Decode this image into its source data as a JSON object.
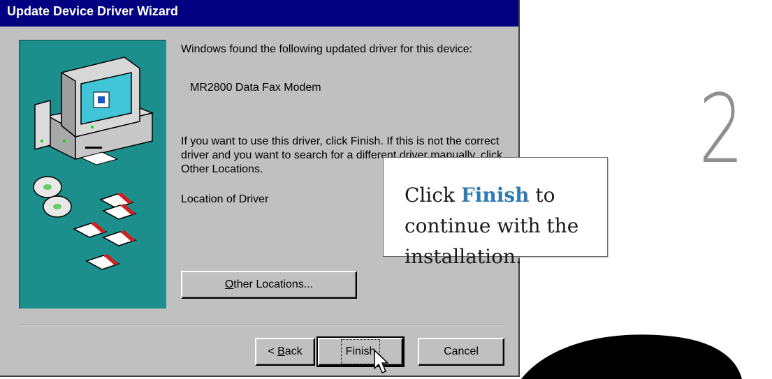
{
  "window": {
    "title": "Update Device Driver Wizard"
  },
  "content": {
    "found_text": "Windows found the following updated driver for this device:",
    "device_name": "MR2800 Data Fax Modem",
    "instruction_text": "If you want to use this driver, click Finish. If this is not the correct driver and you want to search for a different driver manually, click Other Locations.",
    "location_label": "Location of Driver"
  },
  "buttons": {
    "other_locations": {
      "mnemonic": "O",
      "rest": "ther Locations..."
    },
    "back": {
      "prefix": "< ",
      "mnemonic": "B",
      "rest": "ack"
    },
    "finish": "Finish",
    "cancel": "Cancel"
  },
  "callout": {
    "prefix": "Click ",
    "highlight": "Finish",
    "suffix": " to continue with the installation."
  },
  "step_number": "2",
  "colors": {
    "titlebar": "#000080",
    "dialog_bg": "#c0c0c0",
    "art_bg": "#1c8f8c",
    "highlight": "#2f7ab3"
  },
  "icons": [
    "computer-icon",
    "cd-icon",
    "floppy-disk-icon",
    "mouse-cursor-icon"
  ]
}
